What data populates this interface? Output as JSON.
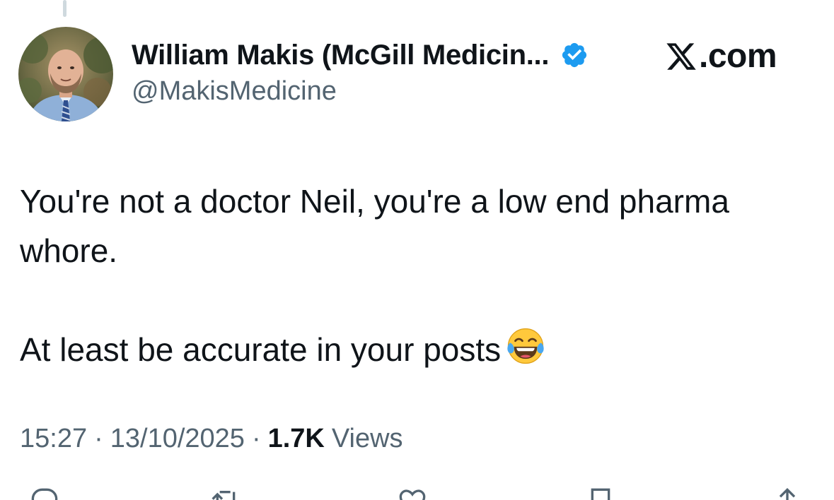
{
  "author": {
    "display_name": "William Makis (McGill Medicin...",
    "handle": "@MakisMedicine",
    "verified": true
  },
  "brand": {
    "suffix": ".com"
  },
  "tweet": {
    "lines": [
      "You're not a doctor Neil, you're a low end pharma",
      "whore.",
      "At least be accurate in your posts"
    ],
    "emoji": "face-with-tears-of-joy"
  },
  "meta": {
    "time": "15:27",
    "separator": "·",
    "date": "13/10/2025",
    "views_count": "1.7K",
    "views_label": "Views"
  },
  "colors": {
    "text_primary": "#0f1419",
    "text_secondary": "#536471",
    "verified_blue": "#1d9bf0",
    "thread_line": "#cfd9de"
  },
  "icons": {
    "verified": "verified-badge-icon",
    "brand": "x-logo-icon",
    "reply": "reply-icon",
    "repost": "repost-icon",
    "like": "heart-icon",
    "bookmark": "bookmark-icon",
    "share": "share-icon"
  }
}
